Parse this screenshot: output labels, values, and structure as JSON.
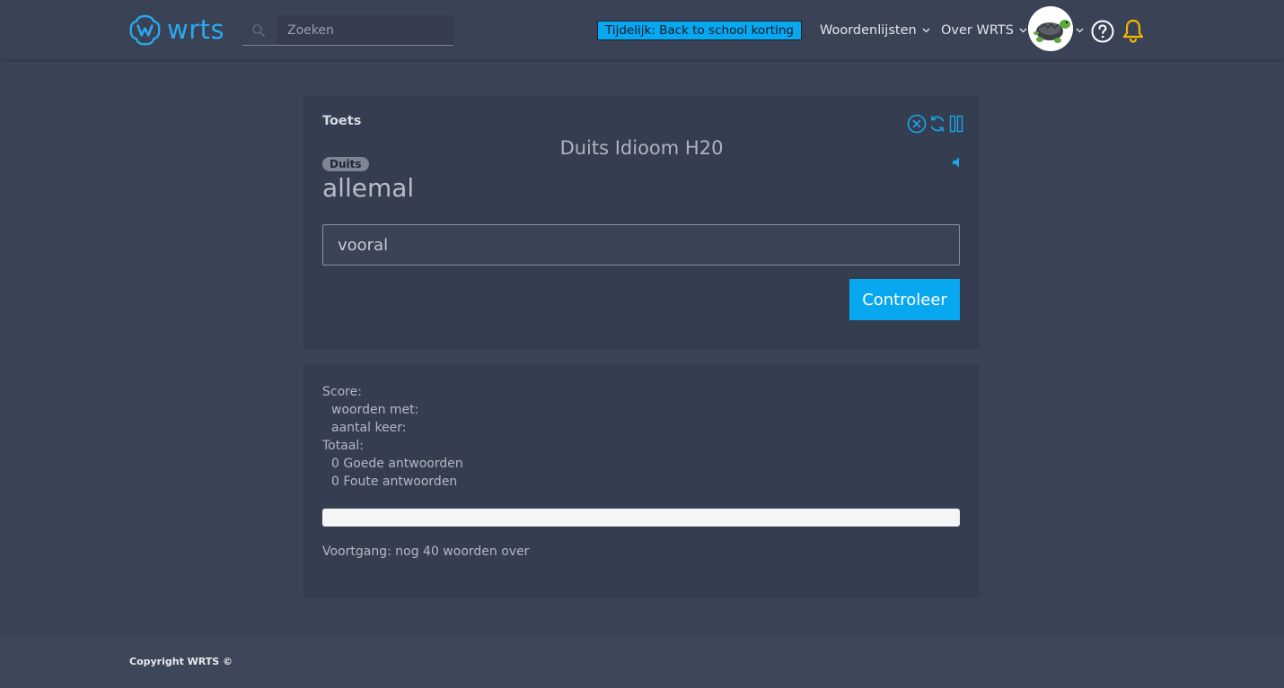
{
  "header": {
    "logo_text": "wrts",
    "search_placeholder": "Zoeken",
    "promo_label": "Tijdelijk: Back to school korting",
    "nav": [
      {
        "label": "Woordenlijsten"
      },
      {
        "label": "Over WRTS"
      }
    ],
    "icons": [
      "search-icon",
      "chevron-down-icon",
      "avatar",
      "help-icon",
      "bell-icon"
    ],
    "bell_color": "#f5b800",
    "accent": "#08a8f0"
  },
  "test": {
    "title": "Toets",
    "controls": [
      "close-circle-icon",
      "restart-icon",
      "pause-icon"
    ],
    "list_title": "Duits Idioom H20",
    "language": "Duits",
    "word": "allemal",
    "answer_value": "vooral",
    "check_label": "Controleer"
  },
  "score": {
    "score_label": "Score:",
    "words_with_label": "woorden met:",
    "times_label": "aantal keer:",
    "total_label": "Totaal:",
    "correct": "0 Goede antwoorden",
    "wrong": "0 Foute antwoorden",
    "progress_fraction": 0,
    "progress_text": "Voortgang: nog 40 woorden over"
  },
  "footer": {
    "copyright": "Copyright WRTS ©"
  }
}
